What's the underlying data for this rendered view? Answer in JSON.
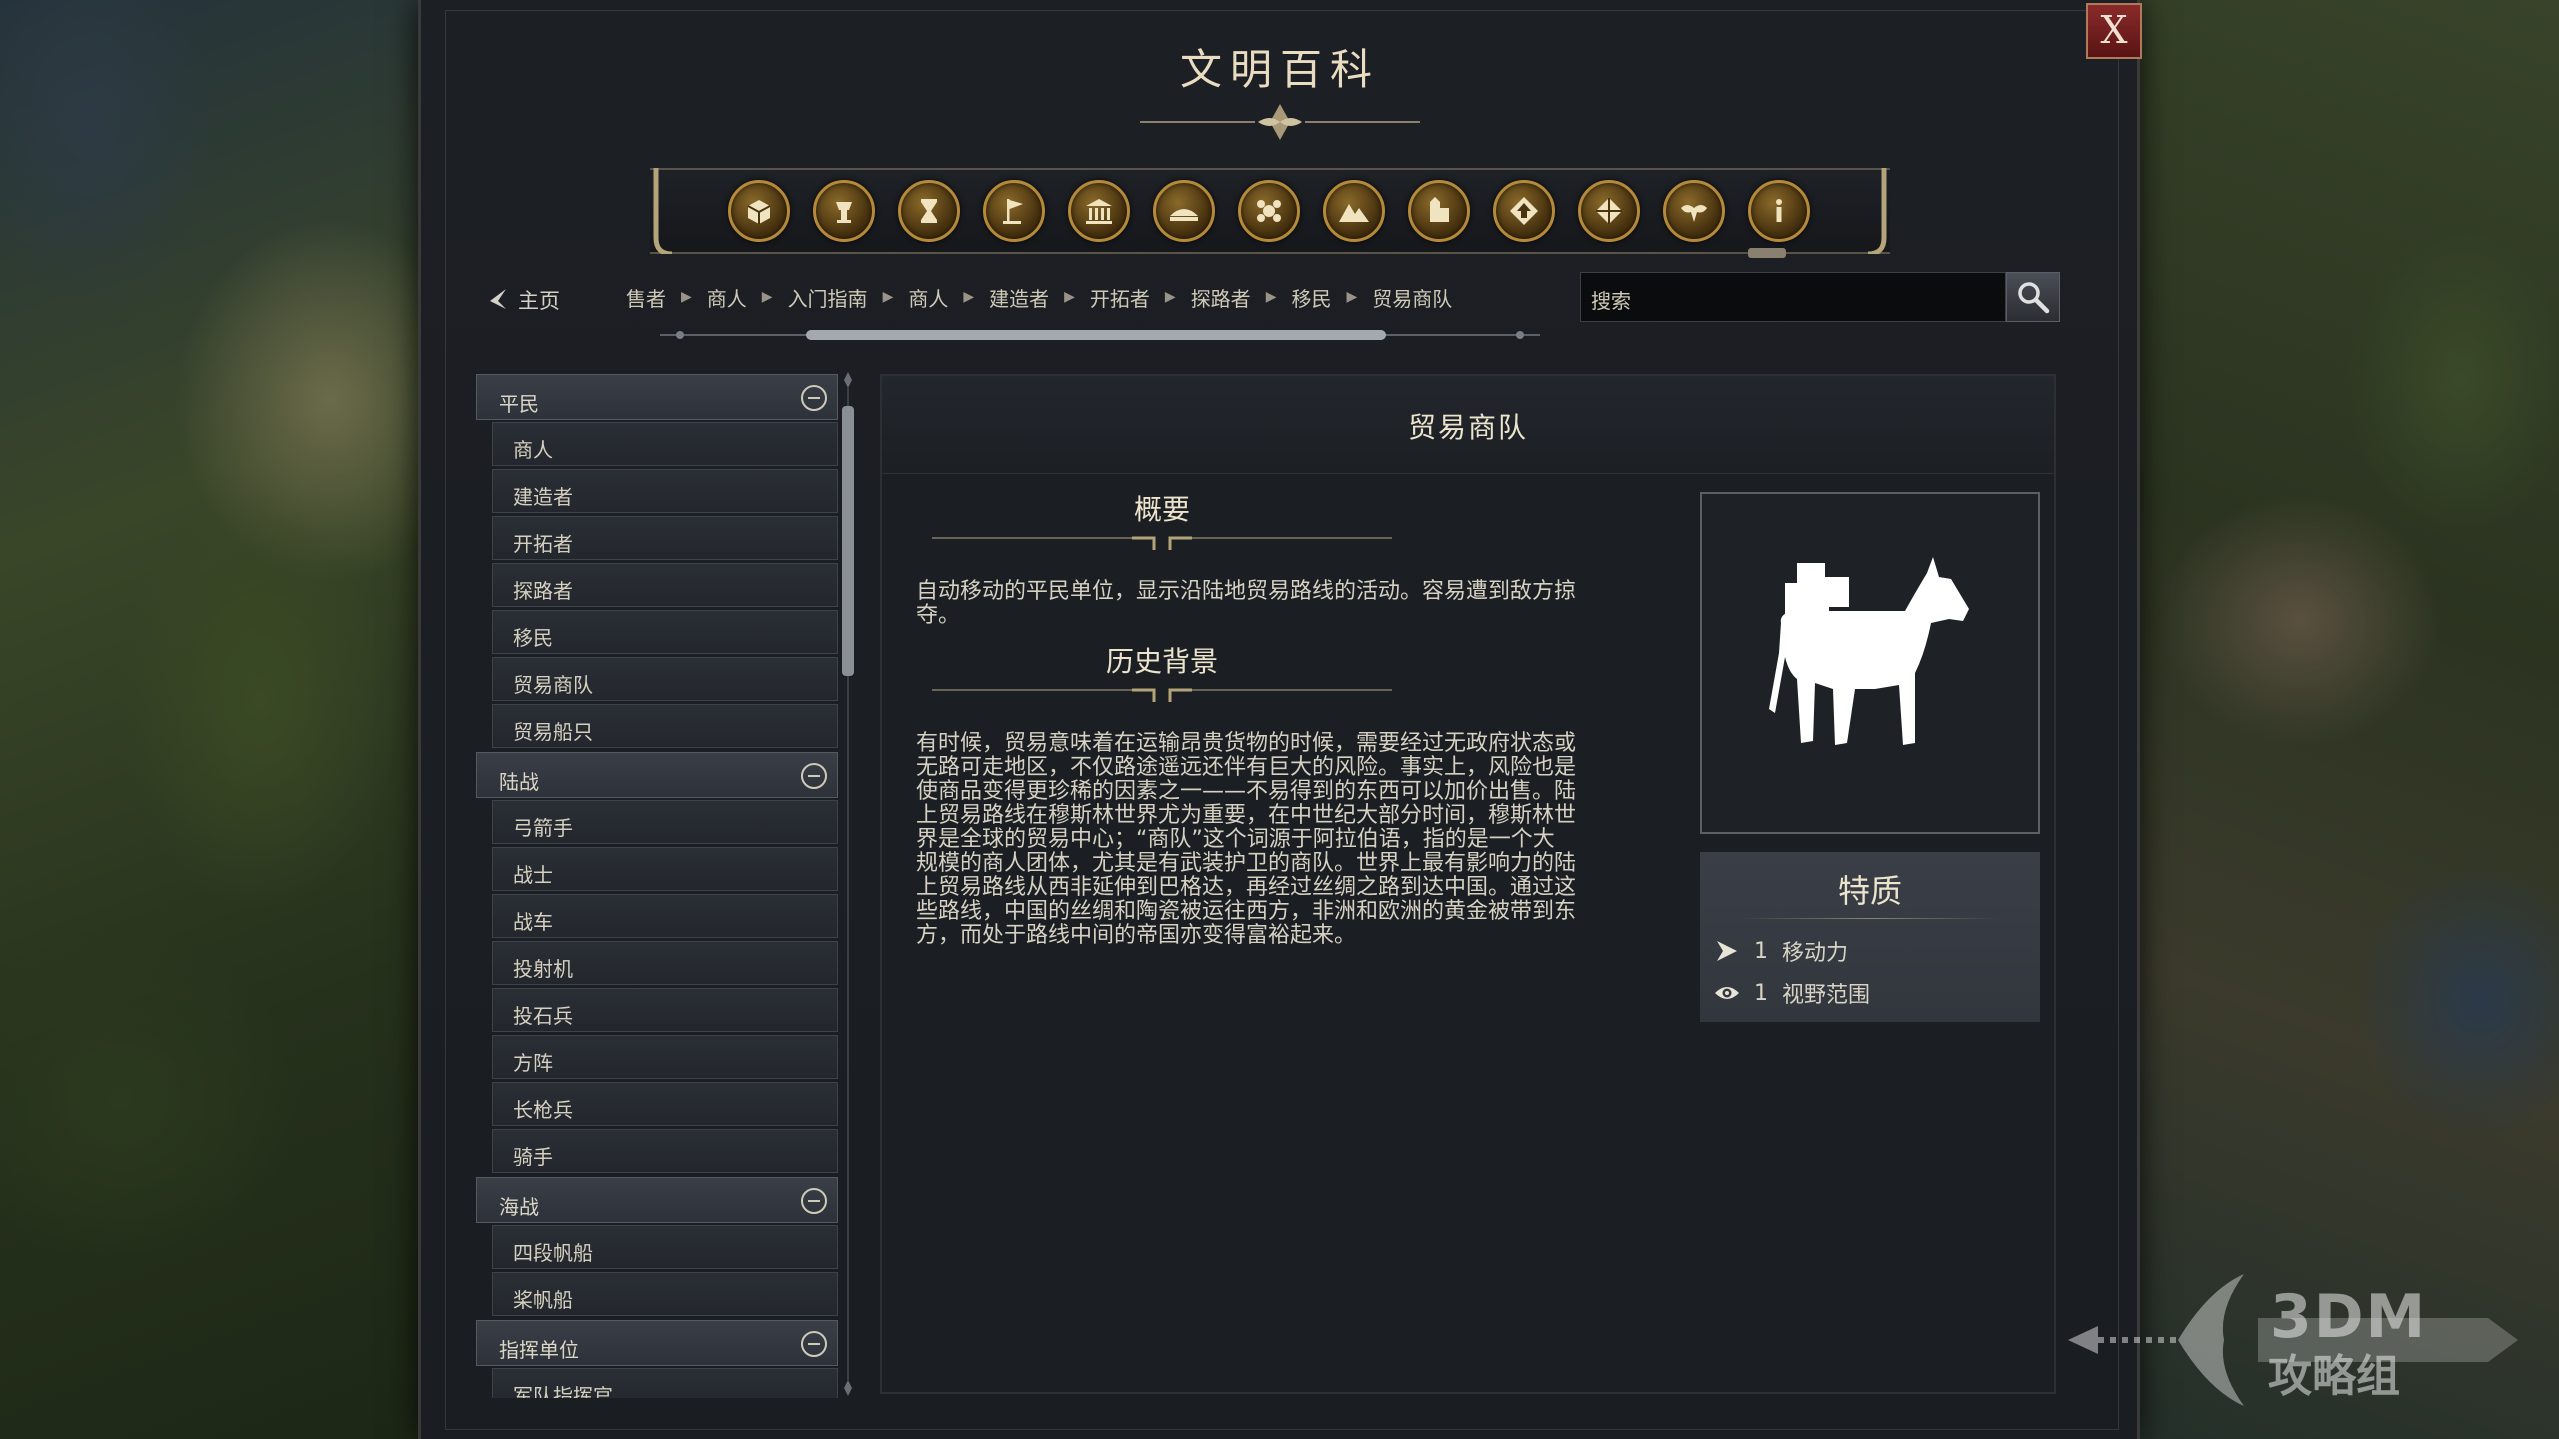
{
  "window": {
    "title": "文明百科",
    "close_label": "X"
  },
  "category_icons": [
    "units-icon",
    "wonders-icon",
    "eras-icon",
    "civilizations-icon",
    "buildings-icon",
    "resources-icon",
    "leaders-icon",
    "terrain-icon",
    "districts-icon",
    "policies-icon",
    "technologies-icon",
    "religion-icon",
    "info-icon"
  ],
  "nav": {
    "home_label": "主页",
    "breadcrumb": [
      "售者",
      "商人",
      "入门指南",
      "商人",
      "建造者",
      "开拓者",
      "探路者",
      "移民",
      "贸易商队"
    ],
    "search_placeholder": "搜索"
  },
  "sidebar": {
    "groups": [
      {
        "label": "平民",
        "items": [
          "商人",
          "建造者",
          "开拓者",
          "探路者",
          "移民",
          "贸易商队",
          "贸易船只"
        ]
      },
      {
        "label": "陆战",
        "items": [
          "弓箭手",
          "战士",
          "战车",
          "投射机",
          "投石兵",
          "方阵",
          "长枪兵",
          "骑手"
        ]
      },
      {
        "label": "海战",
        "items": [
          "四段帆船",
          "桨帆船"
        ]
      },
      {
        "label": "指挥单位",
        "items": [
          "军队指挥官"
        ]
      }
    ]
  },
  "content": {
    "title": "贸易商队",
    "overview_heading": "概要",
    "overview_lines": [
      "自动移动的平民单位，显示沿陆地贸易路线的活动。容易遭到敌方掠",
      "夺。"
    ],
    "history_heading": "历史背景",
    "history_lines": [
      "有时候，贸易意味着在运输昂贵货物的时候，需要经过无政府状态或",
      "无路可走地区，不仅路途遥远还伴有巨大的风险。事实上，风险也是",
      "使商品变得更珍稀的因素之一——不易得到的东西可以加价出售。陆",
      "上贸易路线在穆斯林世界尤为重要，在中世纪大部分时间，穆斯林世",
      "界是全球的贸易中心；“商队”这个词源于阿拉伯语，指的是一个大",
      "规模的商人团体，尤其是有武装护卫的商队。世界上最有影响力的陆",
      "上贸易路线从西非延伸到巴格达，再经过丝绸之路到达中国。通过这",
      "些路线，中国的丝绸和陶瓷被运往西方，非洲和欧洲的黄金被带到东",
      "方，而处于路线中间的帝国亦变得富裕起来。"
    ],
    "portrait_icon": "donkey-caravan-icon",
    "traits_heading": "特质",
    "traits": [
      {
        "icon": "movement-icon",
        "value": "1",
        "label": "移动力"
      },
      {
        "icon": "sight-icon",
        "value": "1",
        "label": "视野范围"
      }
    ]
  },
  "watermark": {
    "line1": "3DM",
    "line2": "攻略组"
  },
  "colors": {
    "gold": "#b48a3a",
    "panel": "#1b1e23",
    "close_red": "#8a2a2a"
  }
}
